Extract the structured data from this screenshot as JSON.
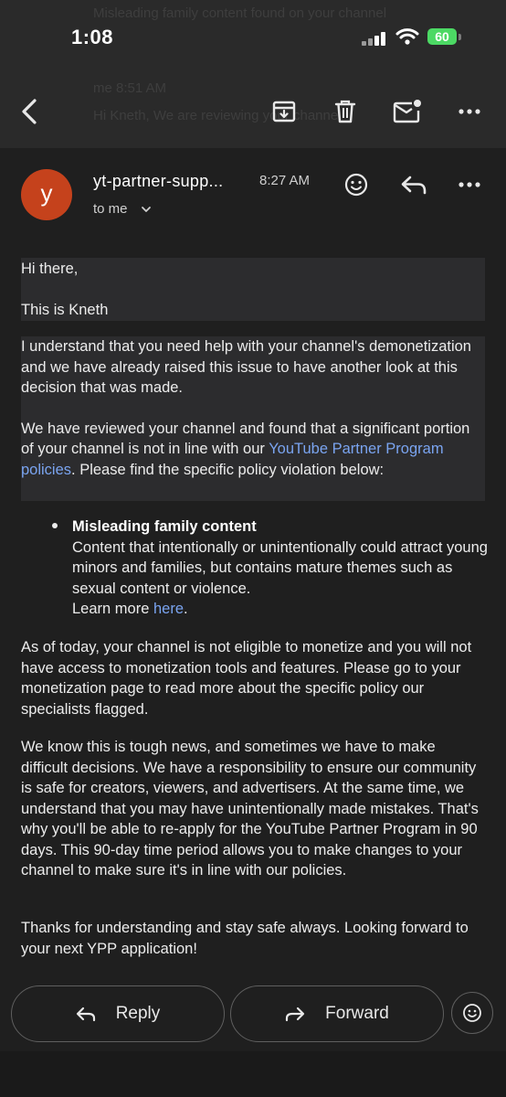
{
  "status_bar": {
    "time": "1:08",
    "battery": "60"
  },
  "background_notification": {
    "line1": "Misleading family content found on your channel",
    "line2": "me  8:51 AM",
    "line3": "Hi Kneth, We are reviewing your channel"
  },
  "toolbar": {
    "back_icon": "arrow-left-icon",
    "archive_icon": "archive-icon",
    "delete_icon": "trash-icon",
    "mark_unread_icon": "mail-unread-icon",
    "more_icon": "more-horizontal-icon"
  },
  "header": {
    "avatar_letter": "y",
    "avatar_color": "#c5421c",
    "sender": "yt-partner-supp...",
    "time": "8:27 AM",
    "recipient": "to me"
  },
  "body": {
    "greeting": "Hi there,",
    "intro": "This is Kneth",
    "p1": "I understand that you need help with your channel's demonetization and we have already raised this issue to have another look at this decision that was made.",
    "p2_before": "We have reviewed your channel and found that a significant portion of your channel is not in line with our ",
    "p2_link": "YouTube Partner Program policies",
    "p2_after": ". Please find the specific policy violation below:",
    "bullet_title": "Misleading family content",
    "bullet_body": "Content that intentionally or unintentionally could attract young minors and families, but contains mature themes such as sexual content or violence.",
    "learn_more": "Learn more ",
    "learn_more_link": "here",
    "learn_more_end": ".",
    "p3": "As of today, your channel is not eligible to monetize and you will not have access to monetization tools and features. Please go to your monetization page to read more about the specific policy our specialists flagged.",
    "p4": "We know this is tough news, and sometimes we have to make difficult decisions. We have a responsibility to ensure our community is safe for creators, viewers, and advertisers. At the same time, we understand that you may have unintentionally made mistakes. That's why you'll be able to re-apply for the YouTube Partner Program in 90 days. This 90-day time period allows you to make changes to your channel to make sure it's in line with our policies.",
    "p5": "Thanks for understanding and stay safe always. Looking forward to your next YPP application!"
  },
  "actions": {
    "reply_label": "Reply",
    "forward_label": "Forward"
  },
  "colors": {
    "background": "#1f1f1f",
    "link": "#7aa4f0",
    "accent_battery": "#4cd964"
  }
}
